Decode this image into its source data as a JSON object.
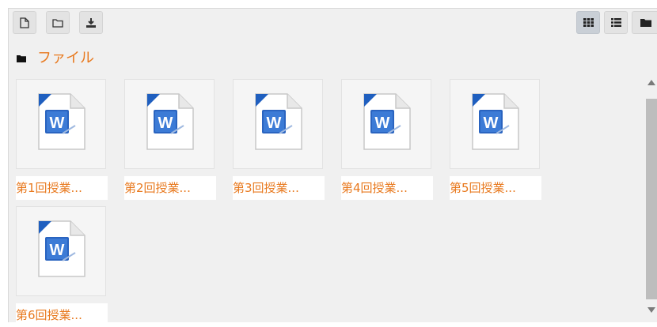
{
  "toolbar": {
    "left_buttons": [
      {
        "icon": "new-file-icon"
      },
      {
        "icon": "new-folder-icon"
      },
      {
        "icon": "download-icon"
      }
    ],
    "view_buttons": [
      {
        "icon": "grid-view-icon",
        "active": true
      },
      {
        "icon": "list-view-icon",
        "active": false
      },
      {
        "icon": "tree-view-icon",
        "active": false
      }
    ]
  },
  "path": {
    "icon": "folder-icon",
    "label": "ファイル"
  },
  "files": [
    {
      "name": "第1回授業...",
      "icon": "word-doc-icon"
    },
    {
      "name": "第2回授業...",
      "icon": "word-doc-icon"
    },
    {
      "name": "第3回授業...",
      "icon": "word-doc-icon"
    },
    {
      "name": "第4回授業...",
      "icon": "word-doc-icon"
    },
    {
      "name": "第5回授業...",
      "icon": "word-doc-icon"
    },
    {
      "name": "第6回授業...",
      "icon": "word-doc-icon"
    }
  ],
  "colors": {
    "accent": "#e8791e",
    "panel": "#f0f0f0",
    "word_blue": "#1f5fbf"
  }
}
